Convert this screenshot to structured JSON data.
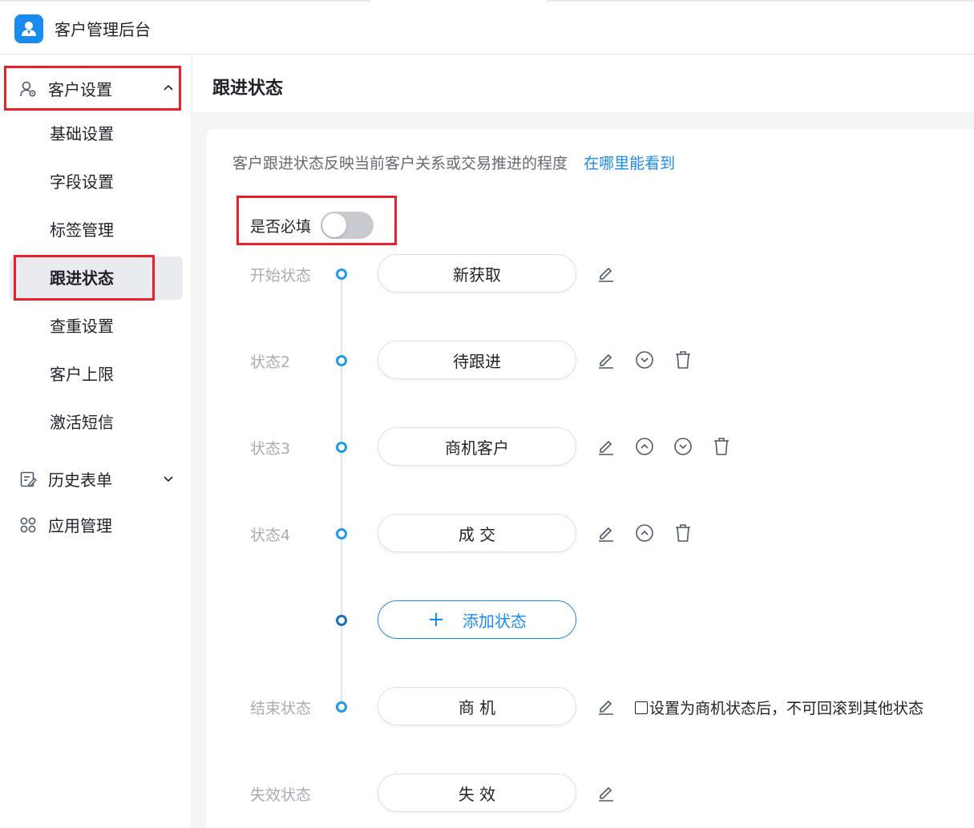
{
  "app": {
    "title": "客户管理后台"
  },
  "sidebar": {
    "group_customer": {
      "label": "客户设置"
    },
    "items": [
      {
        "label": "基础设置"
      },
      {
        "label": "字段设置"
      },
      {
        "label": "标签管理"
      },
      {
        "label": "跟进状态",
        "active": true
      },
      {
        "label": "查重设置"
      },
      {
        "label": "客户上限"
      },
      {
        "label": "激活短信"
      }
    ],
    "group_history": {
      "label": "历史表单"
    },
    "group_apps": {
      "label": "应用管理"
    }
  },
  "page": {
    "title": "跟进状态",
    "description": "客户跟进状态反映当前客户关系或交易推进的程度",
    "help_link": "在哪里能看到",
    "required_label": "是否必填",
    "required_on": false
  },
  "states": [
    {
      "name": "开始状态",
      "value": "新获取",
      "actions": [
        "edit-icon"
      ]
    },
    {
      "name": "状态2",
      "value": "待跟进",
      "actions": [
        "edit-icon",
        "move-down-icon",
        "delete-icon"
      ]
    },
    {
      "name": "状态3",
      "value": "商机客户",
      "actions": [
        "edit-icon",
        "move-up-icon",
        "move-down-icon",
        "delete-icon"
      ]
    },
    {
      "name": "状态4",
      "value": "成 交",
      "actions": [
        "edit-icon",
        "move-up-icon",
        "delete-icon"
      ]
    }
  ],
  "add_state_label": "添加状态",
  "end_state": {
    "name": "结束状态",
    "value": "商 机",
    "note": "设置为商机状态后，不可回滚到其他状态"
  },
  "invalid_state": {
    "name": "失效状态",
    "value": "失 效"
  },
  "colors": {
    "accent": "#1a8cf0",
    "highlight_box": "#e5212a",
    "dot": "#1a9bf0"
  }
}
